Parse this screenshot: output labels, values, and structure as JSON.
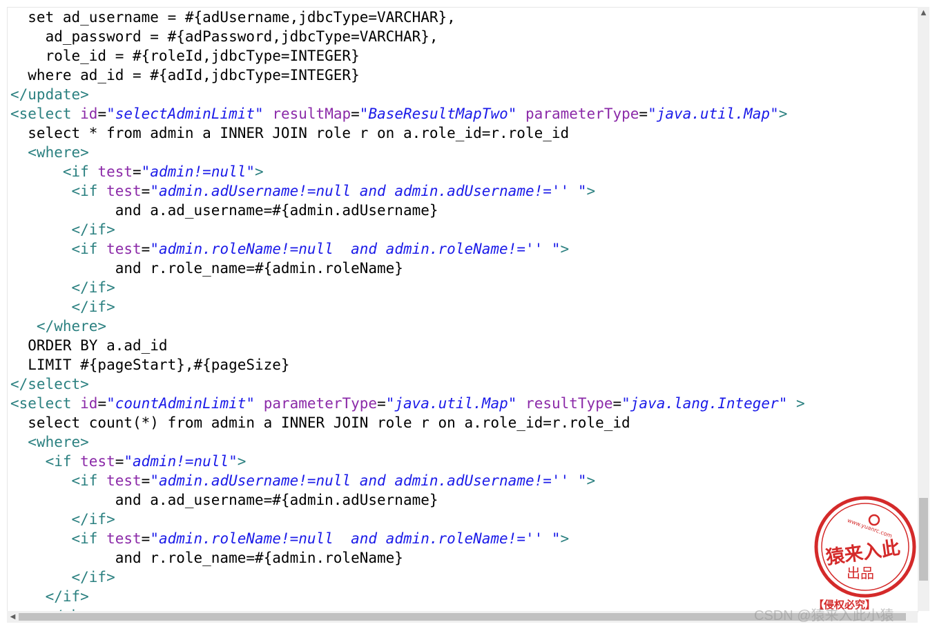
{
  "code_lines": [
    [
      [
        "txt",
        "  set ad_username = #{adUsername,jdbcType=VARCHAR},"
      ]
    ],
    [
      [
        "txt",
        "    ad_password = #{adPassword,jdbcType=VARCHAR},"
      ]
    ],
    [
      [
        "txt",
        "    role_id = #{roleId,jdbcType=INTEGER}"
      ]
    ],
    [
      [
        "txt",
        "  where ad_id = #{adId,jdbcType=INTEGER}"
      ]
    ],
    [
      [
        "tag",
        "</update>"
      ]
    ],
    [
      [
        "tag",
        "<select "
      ],
      [
        "attr",
        "id"
      ],
      [
        "txt",
        "="
      ],
      [
        "val",
        "\"selectAdminLimit\""
      ],
      [
        "txt",
        " "
      ],
      [
        "attr",
        "resultMap"
      ],
      [
        "txt",
        "="
      ],
      [
        "val",
        "\"BaseResultMapTwo\""
      ],
      [
        "txt",
        " "
      ],
      [
        "attr",
        "parameterType"
      ],
      [
        "txt",
        "="
      ],
      [
        "val",
        "\"java.util.Map\""
      ],
      [
        "tag",
        ">"
      ]
    ],
    [
      [
        "txt",
        "  select * from admin a INNER JOIN role r on a.role_id=r.role_id"
      ]
    ],
    [
      [
        "tag",
        "  <where>"
      ]
    ],
    [
      [
        "tag",
        "      <if "
      ],
      [
        "attr",
        "test"
      ],
      [
        "txt",
        "="
      ],
      [
        "val",
        "\"admin!=null\""
      ],
      [
        "tag",
        ">"
      ]
    ],
    [
      [
        "tag",
        "       <if "
      ],
      [
        "attr",
        "test"
      ],
      [
        "txt",
        "="
      ],
      [
        "val",
        "\"admin.adUsername!=null and admin.adUsername!='' \""
      ],
      [
        "tag",
        ">"
      ]
    ],
    [
      [
        "txt",
        "            and a.ad_username=#{admin.adUsername}"
      ]
    ],
    [
      [
        "tag",
        "       </if>"
      ]
    ],
    [
      [
        "tag",
        "       <if "
      ],
      [
        "attr",
        "test"
      ],
      [
        "txt",
        "="
      ],
      [
        "val",
        "\"admin.roleName!=null  and admin.roleName!='' \""
      ],
      [
        "tag",
        ">"
      ]
    ],
    [
      [
        "txt",
        "            and r.role_name=#{admin.roleName}"
      ]
    ],
    [
      [
        "tag",
        "       </if>"
      ]
    ],
    [
      [
        "tag",
        "       </if>"
      ]
    ],
    [
      [
        "tag",
        "   </where>"
      ]
    ],
    [
      [
        "txt",
        "  ORDER BY a.ad_id"
      ]
    ],
    [
      [
        "txt",
        "  LIMIT #{pageStart},#{pageSize}"
      ]
    ],
    [
      [
        "tag",
        "</select>"
      ]
    ],
    [
      [
        "tag",
        "<select "
      ],
      [
        "attr",
        "id"
      ],
      [
        "txt",
        "="
      ],
      [
        "val",
        "\"countAdminLimit\""
      ],
      [
        "txt",
        " "
      ],
      [
        "attr",
        "parameterType"
      ],
      [
        "txt",
        "="
      ],
      [
        "val",
        "\"java.util.Map\""
      ],
      [
        "txt",
        " "
      ],
      [
        "attr",
        "resultType"
      ],
      [
        "txt",
        "="
      ],
      [
        "val",
        "\"java.lang.Integer\""
      ],
      [
        "tag",
        " >"
      ]
    ],
    [
      [
        "txt",
        "  select count(*) from admin a INNER JOIN role r on a.role_id=r.role_id"
      ]
    ],
    [
      [
        "tag",
        "  <where>"
      ]
    ],
    [
      [
        "tag",
        "    <if "
      ],
      [
        "attr",
        "test"
      ],
      [
        "txt",
        "="
      ],
      [
        "val",
        "\"admin!=null\""
      ],
      [
        "tag",
        ">"
      ]
    ],
    [
      [
        "tag",
        "       <if "
      ],
      [
        "attr",
        "test"
      ],
      [
        "txt",
        "="
      ],
      [
        "val",
        "\"admin.adUsername!=null and admin.adUsername!='' \""
      ],
      [
        "tag",
        ">"
      ]
    ],
    [
      [
        "txt",
        "            and a.ad_username=#{admin.adUsername}"
      ]
    ],
    [
      [
        "tag",
        "       </if>"
      ]
    ],
    [
      [
        "tag",
        "       <if "
      ],
      [
        "attr",
        "test"
      ],
      [
        "txt",
        "="
      ],
      [
        "val",
        "\"admin.roleName!=null  and admin.roleName!='' \""
      ],
      [
        "tag",
        ">"
      ]
    ],
    [
      [
        "txt",
        "            and r.role_name=#{admin.roleName}"
      ]
    ],
    [
      [
        "tag",
        "       </if>"
      ]
    ],
    [
      [
        "tag",
        "    </if>"
      ]
    ],
    [
      [
        "tag",
        "    </where>"
      ]
    ]
  ],
  "seal": {
    "url": "www.yuanrc.com",
    "name": "猿来入此",
    "sub": "出品",
    "copyright": "【侵权必究】"
  },
  "watermark": "CSDN @猿来入此小猿",
  "icons": {
    "scroll_up": "scroll-up-arrow-icon",
    "scroll_left": "scroll-left-arrow-icon"
  },
  "colors": {
    "tag": "#2b8080",
    "attr": "#8b2aa8",
    "value": "#1a1ae8",
    "seal": "#d42a2a"
  }
}
